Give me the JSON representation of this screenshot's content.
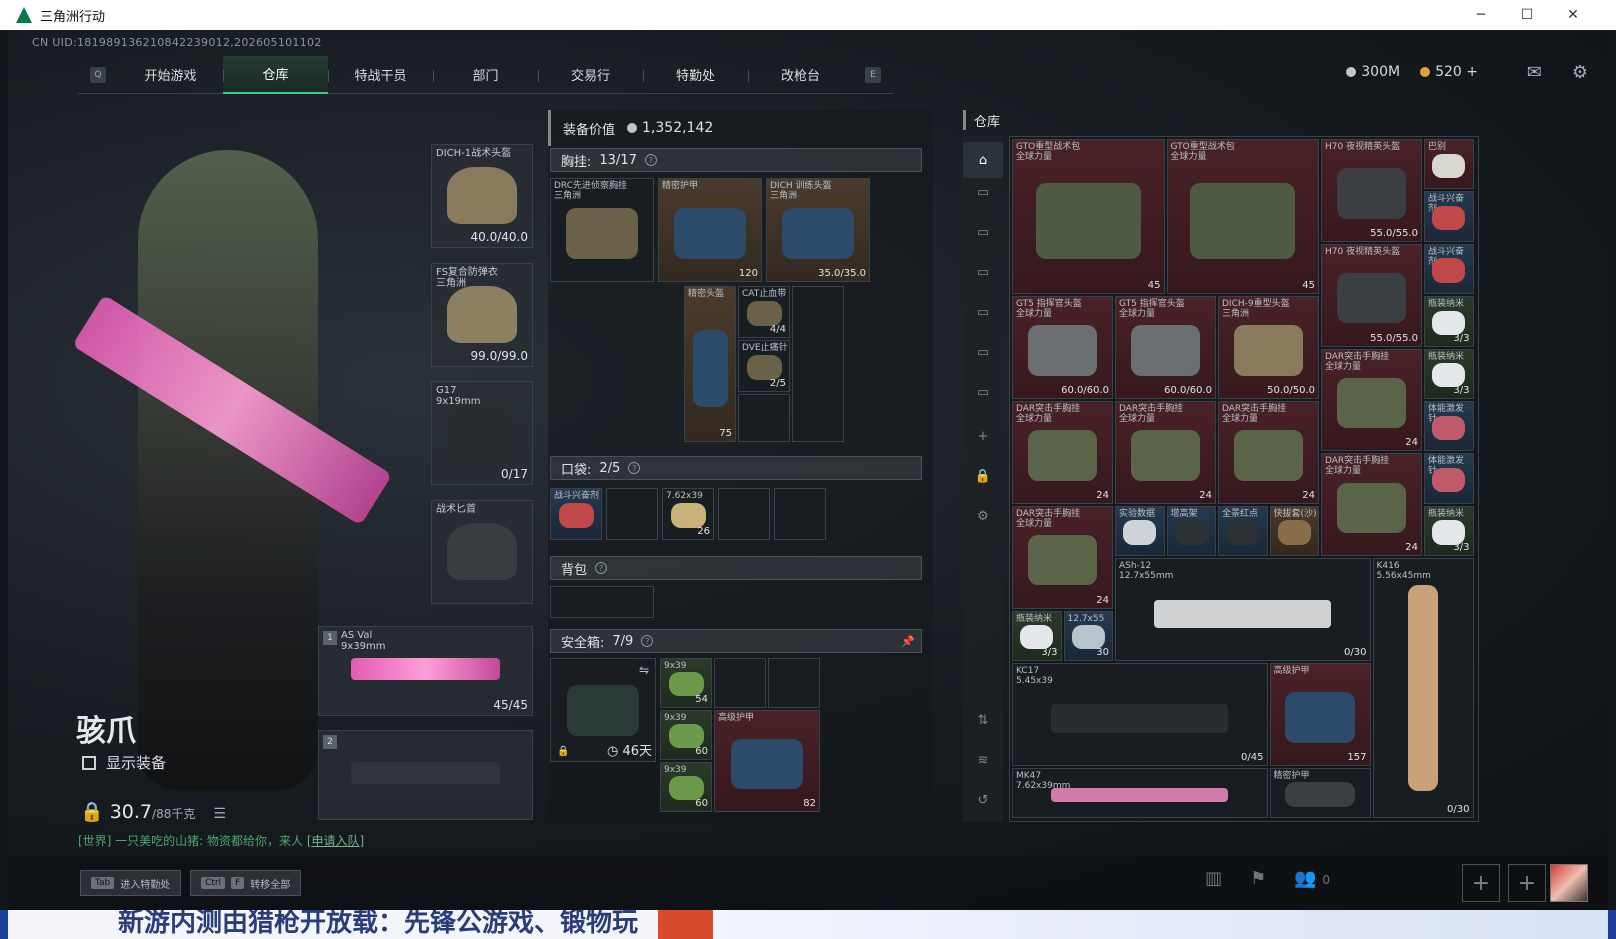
{
  "window": {
    "title": "三角洲行动",
    "controls": [
      "─",
      "☐",
      "✕"
    ]
  },
  "uid": "CN UID:181989136210842239012,202605101102",
  "nav": {
    "key_left": "Q",
    "key_right": "E",
    "tabs": [
      "开始游戏",
      "仓库",
      "特战干员",
      "部门",
      "交易行",
      "特勤处",
      "改枪台"
    ],
    "active_index": 1
  },
  "currency": {
    "silver": "300M",
    "gold": "520",
    "add": "+"
  },
  "operator": {
    "name": "骇爪",
    "show_gear_label": "显示装备",
    "weight": "30.7",
    "weight_max": "/88千克"
  },
  "chat": {
    "text": "[世界] 一只美吃的山猪: 物资都给你，来人",
    "link": "[申请入队]"
  },
  "equip_slots": [
    {
      "name": "DICH-1战术头盔",
      "sub": "",
      "value": "40.0/40.0",
      "color": "#8a7a5c"
    },
    {
      "name": "FS复合防弹衣",
      "sub": "三角洲",
      "value": "99.0/99.0",
      "color": "#8d7f62"
    },
    {
      "name": "G17",
      "sub": "9x19mm",
      "value": "0/17",
      "color": "#2a2d30"
    },
    {
      "name": "战术匕首",
      "sub": "",
      "value": "",
      "color": "#3a3d40"
    }
  ],
  "weapon_slots": [
    {
      "num": "1",
      "name": "AS Val",
      "sub": "9x39mm",
      "value": "45/45"
    },
    {
      "num": "2",
      "name": "",
      "sub": "",
      "value": ""
    }
  ],
  "loadout": {
    "value_label": "装备价值",
    "value": "1,352,142",
    "chest_label": "胸挂:",
    "chest_count": "13/17",
    "chest_items": [
      {
        "name": "DRC先进侦察胸挂",
        "sub": "三角洲",
        "value": "",
        "bg": "gray"
      },
      {
        "name": "精密护甲",
        "sub": "",
        "value": "120",
        "bg": "brown"
      },
      {
        "name": "DICH 训练头盔",
        "sub": "三角洲",
        "value": "35.0/35.0",
        "bg": "brown"
      },
      {
        "name": "精密头盔",
        "sub": "",
        "value": "75",
        "bg": "brown"
      },
      {
        "name": "CAT止血带",
        "sub": "",
        "value": "4/4",
        "bg": "gray"
      },
      {
        "name": "DVE止痛针",
        "sub": "",
        "value": "2/5",
        "bg": "gray"
      }
    ],
    "pocket_label": "口袋:",
    "pocket_count": "2/5",
    "pocket_items": [
      {
        "name": "战斗兴奋剂",
        "value": ""
      },
      {
        "name": "7.62x39",
        "value": "26"
      }
    ],
    "backpack_label": "背包",
    "safe_label": "安全箱:",
    "safe_count": "7/9",
    "safe_timer": "46天",
    "safe_items": [
      {
        "name": "9x39",
        "value": "54"
      },
      {
        "name": "9x39",
        "value": "60"
      },
      {
        "name": "9x39",
        "value": "60"
      },
      {
        "name": "高级护甲",
        "value": "82"
      }
    ]
  },
  "stash": {
    "title": "仓库",
    "items": [
      {
        "name": "GTO重型战术包",
        "sub": "全球力量",
        "value": "45",
        "bg": "red",
        "col": 0,
        "row": 0,
        "w": 3,
        "h": 3,
        "art": "#4f5a43"
      },
      {
        "name": "GTO重型战术包",
        "sub": "全球力量",
        "value": "45",
        "bg": "red",
        "col": 3,
        "row": 0,
        "w": 3,
        "h": 3,
        "art": "#4f5a43"
      },
      {
        "name": "H70 夜视精英头盔",
        "sub": "",
        "value": "55.0/55.0",
        "bg": "red",
        "col": 6,
        "row": 0,
        "w": 2,
        "h": 2,
        "art": "#3b3f44"
      },
      {
        "name": "巴别",
        "sub": "",
        "value": "",
        "bg": "red",
        "col": 8,
        "row": 0,
        "w": 1,
        "h": 1,
        "art": "#d8d8d0"
      },
      {
        "name": "战斗兴奋剂",
        "sub": "",
        "value": "",
        "bg": "blue",
        "col": 8,
        "row": 1,
        "w": 1,
        "h": 1,
        "art": "#c04848"
      },
      {
        "name": "H70 夜视精英头盔",
        "sub": "",
        "value": "55.0/55.0",
        "bg": "red",
        "col": 6,
        "row": 2,
        "w": 2,
        "h": 2,
        "art": "#3b3f44"
      },
      {
        "name": "战斗兴奋剂",
        "sub": "",
        "value": "",
        "bg": "blue",
        "col": 8,
        "row": 2,
        "w": 1,
        "h": 1,
        "art": "#c04848"
      },
      {
        "name": "GT5 指挥官头盔",
        "sub": "全球力量",
        "value": "60.0/60.0",
        "bg": "red",
        "col": 0,
        "row": 3,
        "w": 2,
        "h": 2,
        "art": "#6a6f72"
      },
      {
        "name": "GT5 指挥官头盔",
        "sub": "全球力量",
        "value": "60.0/60.0",
        "bg": "red",
        "col": 2,
        "row": 3,
        "w": 2,
        "h": 2,
        "art": "#6a6f72"
      },
      {
        "name": "DICH-9重型头盔",
        "sub": "三角洲",
        "value": "50.0/50.0",
        "bg": "red",
        "col": 4,
        "row": 3,
        "w": 2,
        "h": 2,
        "art": "#8a7a5c"
      },
      {
        "name": "瓶装纳米",
        "sub": "",
        "value": "3/3",
        "bg": "green",
        "col": 8,
        "row": 3,
        "w": 1,
        "h": 1,
        "art": "#e4e8ea"
      },
      {
        "name": "DAR突击手胸挂",
        "sub": "全球力量",
        "value": "24",
        "bg": "red",
        "col": 6,
        "row": 4,
        "w": 2,
        "h": 2,
        "art": "#5a6449"
      },
      {
        "name": "瓶装纳米",
        "sub": "",
        "value": "3/3",
        "bg": "green",
        "col": 8,
        "row": 4,
        "w": 1,
        "h": 1,
        "art": "#e4e8ea"
      },
      {
        "name": "DAR突击手胸挂",
        "sub": "全球力量",
        "value": "24",
        "bg": "red",
        "col": 0,
        "row": 5,
        "w": 2,
        "h": 2,
        "art": "#5a6449"
      },
      {
        "name": "DAR突击手胸挂",
        "sub": "全球力量",
        "value": "24",
        "bg": "red",
        "col": 2,
        "row": 5,
        "w": 2,
        "h": 2,
        "art": "#5a6449"
      },
      {
        "name": "DAR突击手胸挂",
        "sub": "全球力量",
        "value": "24",
        "bg": "red",
        "col": 4,
        "row": 5,
        "w": 2,
        "h": 2,
        "art": "#5a6449"
      },
      {
        "name": "体能激发针",
        "sub": "",
        "value": "",
        "bg": "blue",
        "col": 8,
        "row": 5,
        "w": 1,
        "h": 1,
        "art": "#c05a6a"
      },
      {
        "name": "DAR突击手胸挂",
        "sub": "全球力量",
        "value": "24",
        "bg": "red",
        "col": 6,
        "row": 6,
        "w": 2,
        "h": 2,
        "art": "#5a6449"
      },
      {
        "name": "体能激发针",
        "sub": "",
        "value": "",
        "bg": "blue",
        "col": 8,
        "row": 6,
        "w": 1,
        "h": 1,
        "art": "#c05a6a"
      },
      {
        "name": "DAR突击手胸挂",
        "sub": "全球力量",
        "value": "24",
        "bg": "red",
        "col": 0,
        "row": 7,
        "w": 2,
        "h": 2,
        "art": "#5a6449"
      },
      {
        "name": "实验数据",
        "sub": "",
        "value": "",
        "bg": "blue",
        "col": 2,
        "row": 7,
        "w": 1,
        "h": 1,
        "art": "#d0d4d8"
      },
      {
        "name": "增高架",
        "sub": "",
        "value": "",
        "bg": "blue",
        "col": 3,
        "row": 7,
        "w": 1,
        "h": 1,
        "art": "#2c3136"
      },
      {
        "name": "全景红点",
        "sub": "",
        "value": "",
        "bg": "blue",
        "col": 4,
        "row": 7,
        "w": 1,
        "h": 1,
        "art": "#2c3136"
      },
      {
        "name": "快拔套(沙)",
        "sub": "",
        "value": "",
        "bg": "brown",
        "col": 5,
        "row": 7,
        "w": 1,
        "h": 1,
        "art": "#8a6d4a"
      },
      {
        "name": "瓶装纳米",
        "sub": "",
        "value": "3/3",
        "bg": "green",
        "col": 8,
        "row": 7,
        "w": 1,
        "h": 1,
        "art": "#e4e8ea"
      },
      {
        "name": "ASh-12",
        "sub": "12.7x55mm",
        "value": "0/30",
        "bg": "gray",
        "col": 2,
        "row": 8,
        "w": 5,
        "h": 2,
        "art": "#cfd1d3"
      },
      {
        "name": "K416",
        "sub": "5.56x45mm",
        "value": "0/30",
        "bg": "gray",
        "col": 7,
        "row": 8,
        "w": 2,
        "h": 5,
        "art": "#c9a27a"
      },
      {
        "name": "瓶装纳米",
        "sub": "",
        "value": "3/3",
        "bg": "green",
        "col": 0,
        "row": 9,
        "w": 1,
        "h": 1,
        "art": "#e4e8ea"
      },
      {
        "name": "12.7x55",
        "sub": "",
        "value": "30",
        "bg": "blue",
        "col": 1,
        "row": 9,
        "w": 1,
        "h": 1,
        "art": "#b8c4cc"
      },
      {
        "name": "KC17",
        "sub": "5.45x39",
        "value": "0/45",
        "bg": "gray",
        "col": 0,
        "row": 10,
        "w": 5,
        "h": 2,
        "art": "#2a2d30"
      },
      {
        "name": "高级护甲",
        "sub": "",
        "value": "157",
        "bg": "red",
        "col": 5,
        "row": 10,
        "w": 2,
        "h": 2,
        "art": "#2c4a6a"
      },
      {
        "name": "MK47",
        "sub": "7.62x39mm",
        "value": "",
        "bg": "gray",
        "col": 0,
        "row": 12,
        "w": 5,
        "h": 1,
        "art": "#d27aa8"
      },
      {
        "name": "精密护甲",
        "sub": "",
        "value": "",
        "bg": "gray",
        "col": 5,
        "row": 12,
        "w": 2,
        "h": 1,
        "art": "#3b3f44"
      }
    ]
  },
  "stash_sidebar": [
    "vault-icon",
    "category-icon",
    "category-icon",
    "category-icon",
    "category-icon",
    "category-icon",
    "category-icon",
    "add-icon",
    "lock-icon",
    "settings-icon",
    "sort-icon",
    "layers-icon",
    "recycle-icon"
  ],
  "bottom": {
    "hint1_key": "Tab",
    "hint1_label": "进入特勤处",
    "hint2_key1": "Ctrl",
    "hint2_key2": "F",
    "hint2_label": "转移全部",
    "friends_count": "0"
  },
  "taskbar": {
    "ticker": "新游内测由猎枪开放载：先锋公游戏、锻物玩"
  },
  "colors": {
    "accent": "#2fd08c",
    "silver_coin": "#c0c6cc",
    "gold_coin": "#e0a23a",
    "rare_red": "#4a2228"
  }
}
